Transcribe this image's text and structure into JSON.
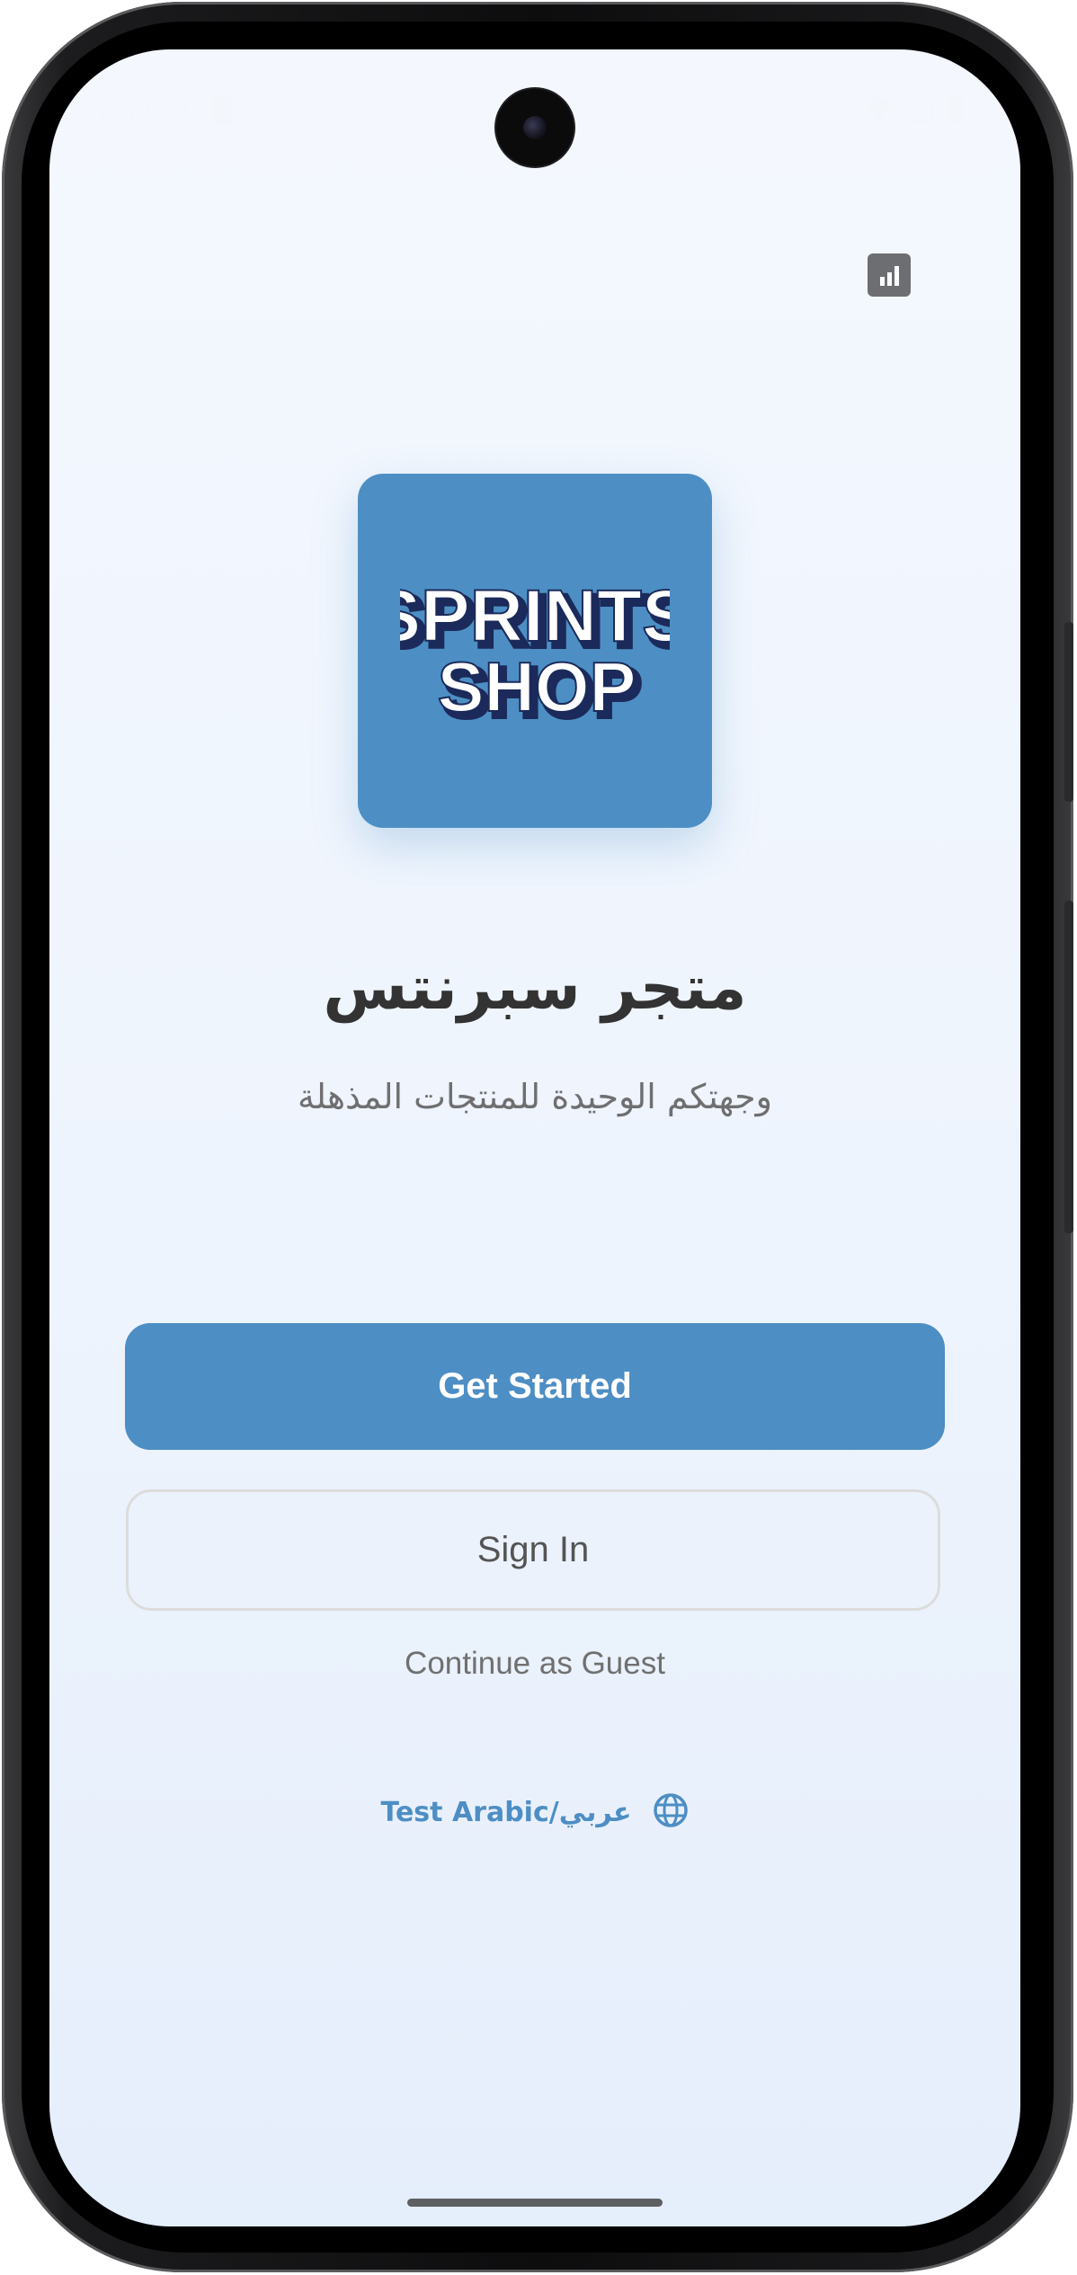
{
  "status_bar": {
    "time": "5:08",
    "left_icons": [
      "vpn-shield-icon",
      "sim-card-icon"
    ],
    "right_icons": [
      "wifi-icon",
      "signal-icon",
      "battery-icon"
    ]
  },
  "toolbar": {
    "analytics_icon": "bar-chart-icon"
  },
  "logo": {
    "line1": "SPRINTS",
    "line2": "SHOP",
    "tile_color": "#4d8fc4"
  },
  "hero": {
    "title": "متجر سبرنتس",
    "subtitle": "وجهتكم الوحيدة للمنتجات المذهلة"
  },
  "actions": {
    "get_started": "Get Started",
    "sign_in": "Sign In",
    "guest": "Continue as Guest",
    "language": "Test Arabic/عربي",
    "language_icon": "globe-icon"
  },
  "colors": {
    "primary": "#4d8ec4",
    "text_dark": "#333333",
    "text_muted": "#707070"
  }
}
